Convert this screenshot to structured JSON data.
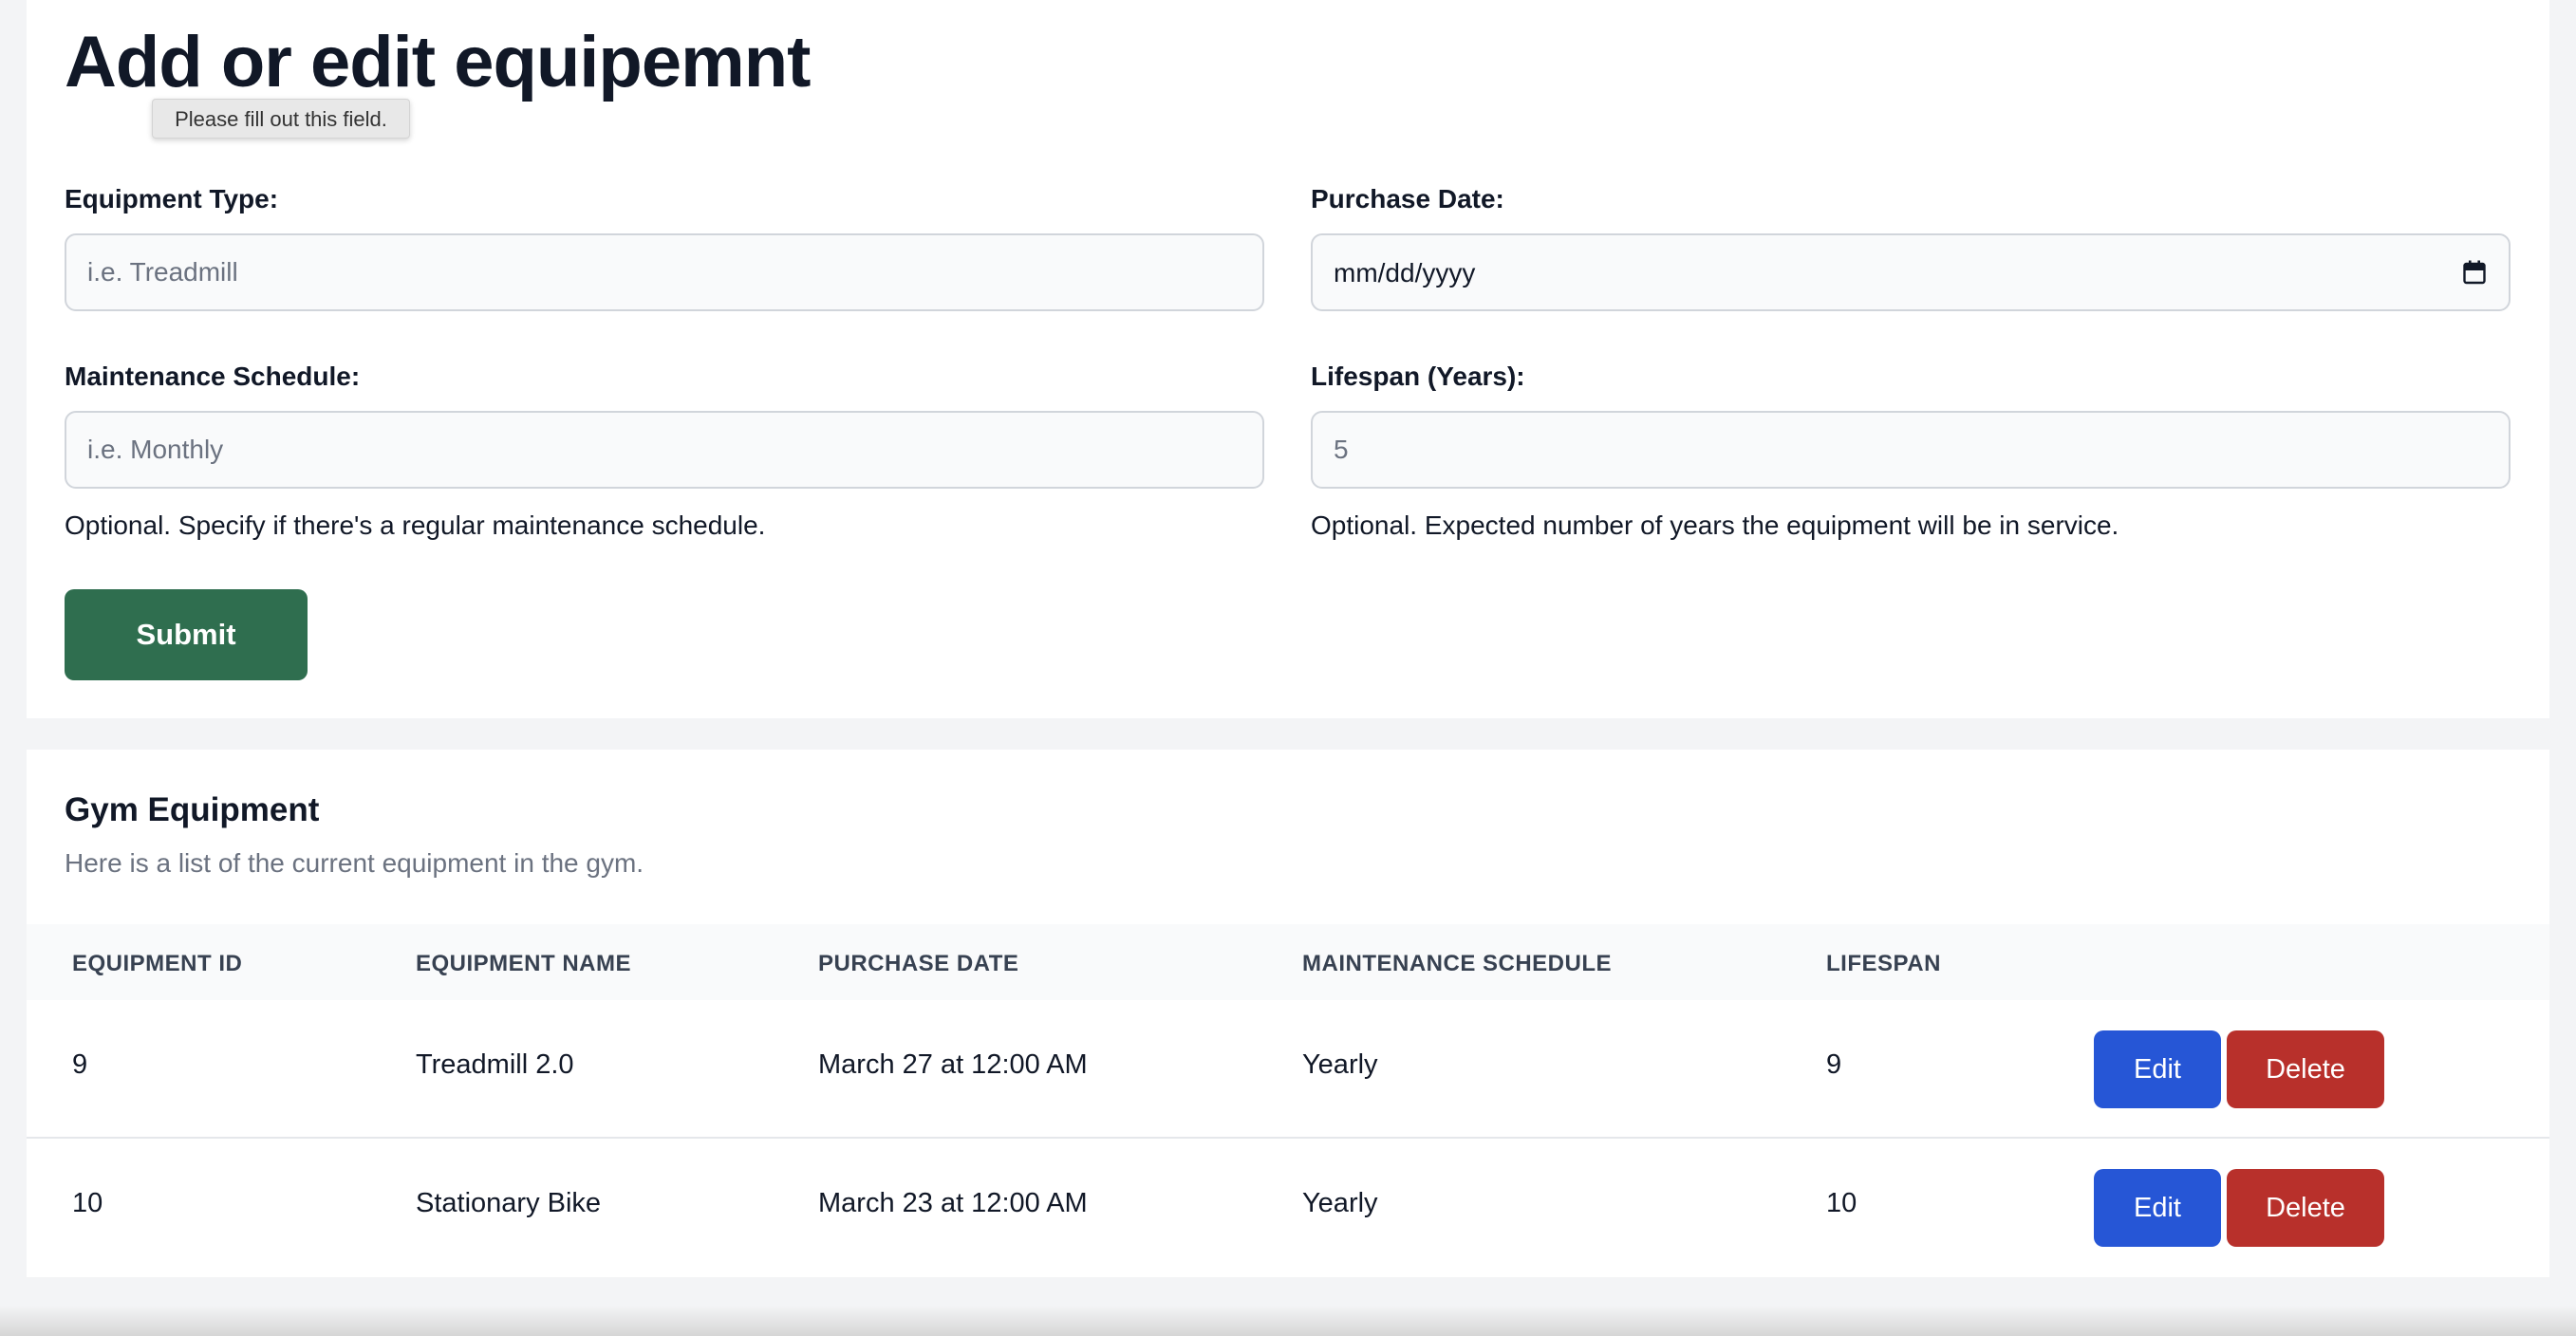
{
  "form": {
    "title": "Add or edit equipemnt",
    "tooltip": "Please fill out this field.",
    "equipment_type": {
      "label": "Equipment Type:",
      "placeholder": "i.e. Treadmill"
    },
    "purchase_date": {
      "label": "Purchase Date:",
      "value": "mm/dd/yyyy"
    },
    "maintenance_schedule": {
      "label": "Maintenance Schedule:",
      "placeholder": "i.e. Monthly",
      "help": "Optional. Specify if there's a regular maintenance schedule."
    },
    "lifespan": {
      "label": "Lifespan (Years):",
      "placeholder": "5",
      "help": "Optional. Expected number of years the equipment will be in service."
    },
    "submit_label": "Submit"
  },
  "list": {
    "title": "Gym Equipment",
    "description": "Here is a list of the current equipment in the gym.",
    "columns": [
      "EQUIPMENT ID",
      "EQUIPMENT NAME",
      "PURCHASE DATE",
      "MAINTENANCE SCHEDULE",
      "LIFESPAN"
    ],
    "rows": [
      {
        "id": "9",
        "name": "Treadmill 2.0",
        "purchase_date": "March 27 at 12:00 AM",
        "maintenance": "Yearly",
        "lifespan": "9",
        "edit": "Edit",
        "delete": "Delete"
      },
      {
        "id": "10",
        "name": "Stationary Bike",
        "purchase_date": "March 23 at 12:00 AM",
        "maintenance": "Yearly",
        "lifespan": "10",
        "edit": "Edit",
        "delete": "Delete"
      }
    ]
  },
  "colors": {
    "submit": "#2f6e4f",
    "edit": "#2656d6",
    "delete": "#b8302b"
  },
  "icons": {
    "date_picker": "calendar-icon"
  }
}
